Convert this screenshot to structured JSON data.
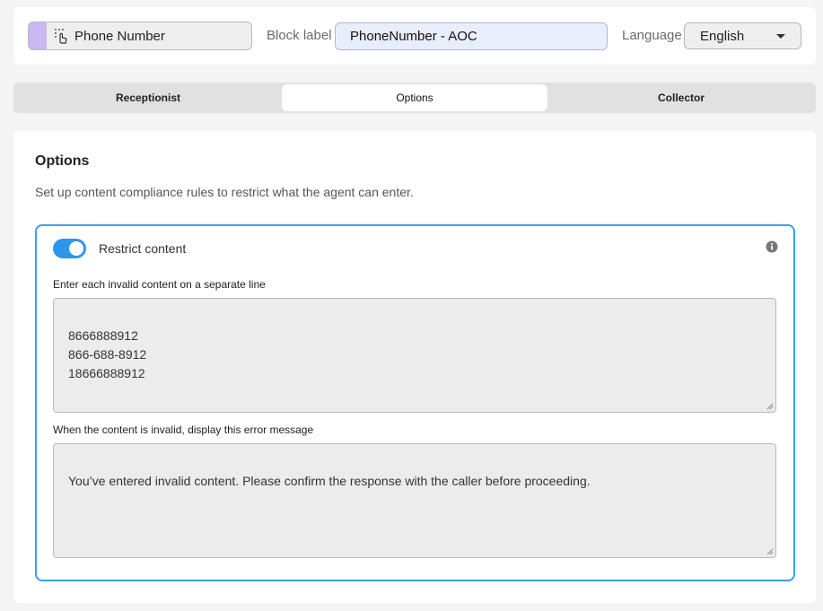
{
  "header": {
    "block_name": "Phone Number",
    "block_label_caption": "Block label",
    "block_label_value": "PhoneNumber - AOC",
    "language_caption": "Language",
    "language_value": "English"
  },
  "tabs": [
    {
      "label": "Receptionist",
      "active": false
    },
    {
      "label": "Options",
      "active": true
    },
    {
      "label": "Collector",
      "active": false
    }
  ],
  "options": {
    "title": "Options",
    "description": "Set up content compliance rules to restrict what the agent can enter.",
    "restrict": {
      "label": "Restrict content",
      "enabled": true,
      "invalid_label": "Enter each invalid content on a separate line",
      "invalid_lines": [
        "8666888912",
        "866-688-8912",
        "18666888912"
      ],
      "error_label": "When the content is invalid, display this error message",
      "error_message": "You’ve entered invalid content. Please confirm the response with the caller before proceeding."
    }
  },
  "colors": {
    "accent": "#2f96ee",
    "pill_accent": "#c9b8f0",
    "input_bg": "#e8eefc"
  },
  "icons": {
    "block": "touch-pointer-icon",
    "info": "info-icon",
    "dropdown": "caret-down-icon"
  }
}
